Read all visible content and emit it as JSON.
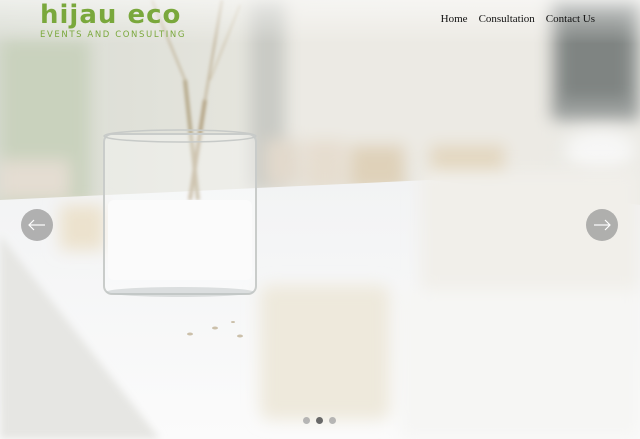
{
  "brand": {
    "name": "hijau eco",
    "tagline": "EVENTS AND CONSULTING",
    "color": "#7aa83c"
  },
  "nav": {
    "items": [
      {
        "label": "Home"
      },
      {
        "label": "Consultation"
      },
      {
        "label": "Contact Us"
      }
    ]
  },
  "slider": {
    "prev_icon": "arrow-left-icon",
    "next_icon": "arrow-right-icon",
    "slide_count": 3,
    "active_slide": 2
  }
}
